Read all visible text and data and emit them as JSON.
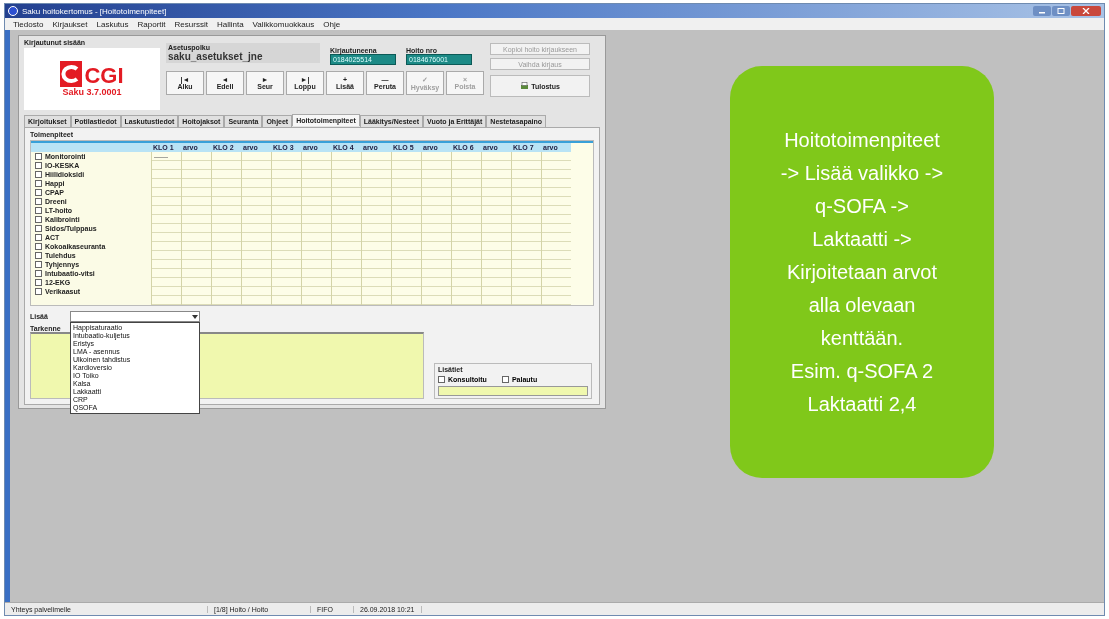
{
  "window": {
    "title": "Saku hoitokertomus - [Hoitotoimenpiteet]"
  },
  "menu": [
    "Tiedosto",
    "Kirjaukset",
    "Laskutus",
    "Raportit",
    "Resurssit",
    "Hallinta",
    "Valikkomuokkaus",
    "Ohje"
  ],
  "form": {
    "group_title": "Kirjautunut sisään",
    "logo": {
      "brand": "CGI",
      "version": "Saku 3.7.0001"
    },
    "path": {
      "label": "Asetuspolku",
      "value": "saku_asetukset_jne"
    },
    "fields": [
      {
        "label": "Kirjautuneena",
        "value": "0184025514"
      },
      {
        "label": "Hoito nro",
        "value": "0184676001"
      }
    ],
    "nav_buttons": [
      {
        "symbol": "|◄",
        "label": "Alku",
        "disabled": false
      },
      {
        "symbol": "◄",
        "label": "Edell",
        "disabled": false
      },
      {
        "symbol": "►",
        "label": "Seur",
        "disabled": false
      },
      {
        "symbol": "►|",
        "label": "Loppu",
        "disabled": false
      },
      {
        "symbol": "+",
        "label": "Lisää",
        "disabled": false
      },
      {
        "symbol": "—",
        "label": "Peruta",
        "disabled": false
      },
      {
        "symbol": "✓",
        "label": "Hyväksy",
        "disabled": true
      },
      {
        "symbol": "×",
        "label": "Poista",
        "disabled": true
      }
    ],
    "side_buttons": [
      {
        "label": "Kopioi hoito kirjaukseen",
        "disabled": true
      },
      {
        "label": "Vaihda kirjaus",
        "disabled": true
      },
      {
        "label": "Tulostus",
        "disabled": false
      }
    ],
    "tabs": [
      {
        "label": "Kirjoitukset",
        "selected": false
      },
      {
        "label": "Potilastiedot",
        "selected": false
      },
      {
        "label": "Laskutustiedot",
        "selected": false
      },
      {
        "label": "Hoitojaksot",
        "selected": false
      },
      {
        "label": "Seuranta",
        "selected": false
      },
      {
        "label": "Ohjeet",
        "selected": false
      },
      {
        "label": "Hoitotoimenpiteet",
        "selected": true
      },
      {
        "label": "Lääkitys/Nesteet",
        "selected": false
      },
      {
        "label": "Vuoto ja Erittäjät",
        "selected": false
      },
      {
        "label": "Nestetasapaino",
        "selected": false
      }
    ],
    "procedures": {
      "title": "Toimenpiteet",
      "columns": [
        "KLO 1",
        "arvo",
        "KLO 2",
        "arvo",
        "KLO 3",
        "arvo",
        "KLO 4",
        "arvo",
        "KLO 5",
        "arvo",
        "KLO 6",
        "arvo",
        "KLO 7",
        "arvo"
      ],
      "items": [
        {
          "label": "Monitorointi",
          "checked": false,
          "cells": [
            "——"
          ]
        },
        {
          "label": "IO-KESKA",
          "checked": false
        },
        {
          "label": "Hiilidioksidi",
          "checked": false
        },
        {
          "label": "Happi",
          "checked": false
        },
        {
          "label": "CPAP",
          "checked": false
        },
        {
          "label": "Dreeni",
          "checked": false
        },
        {
          "label": "LT-hoito",
          "checked": false
        },
        {
          "label": "Kalibrointi",
          "checked": false
        },
        {
          "label": "Sidos/Tulppaus",
          "checked": false
        },
        {
          "label": "ACT",
          "checked": false
        },
        {
          "label": "Kokoaikaseuranta",
          "checked": false
        },
        {
          "label": "Tulehdus",
          "checked": false
        },
        {
          "label": "Tyhjennys",
          "checked": false
        },
        {
          "label": "Intubaatio-vitsi",
          "checked": false
        },
        {
          "label": "12-EKG",
          "checked": false
        },
        {
          "label": "Verikaasut",
          "checked": false
        }
      ]
    },
    "add": {
      "label": "Lisää",
      "options": [
        "Happisaturaatio",
        "Intubaatio-kuljetus",
        "Eristys",
        "LMA - asennus",
        "Ulkoinen tahdistus",
        "Kardioversio",
        "IO Toiko",
        "Kalsa",
        "Lakkaatti",
        "CRP",
        "QSOFA"
      ]
    },
    "notes": {
      "label": "Tarkenne"
    },
    "extra": {
      "title": "Lisätiet",
      "checks": [
        {
          "label": "Konsultoitu",
          "checked": false
        },
        {
          "label": "Palautu",
          "checked": false
        }
      ]
    }
  },
  "callout": {
    "lines": [
      "Hoitotoimenpiteet",
      "-> Lisää valikko ->",
      "q-SOFA ->",
      "Laktaatti ->",
      "Kirjoitetaan arvot",
      "alla olevaan",
      "kenttään.",
      "Esim. q-SOFA 2",
      "Laktaatti 2,4"
    ]
  },
  "status_bar": [
    "Yhteys palvelimelle",
    "[1/8] Hoito / Hoito",
    "FIFO",
    "26.09.2018 10:21"
  ]
}
